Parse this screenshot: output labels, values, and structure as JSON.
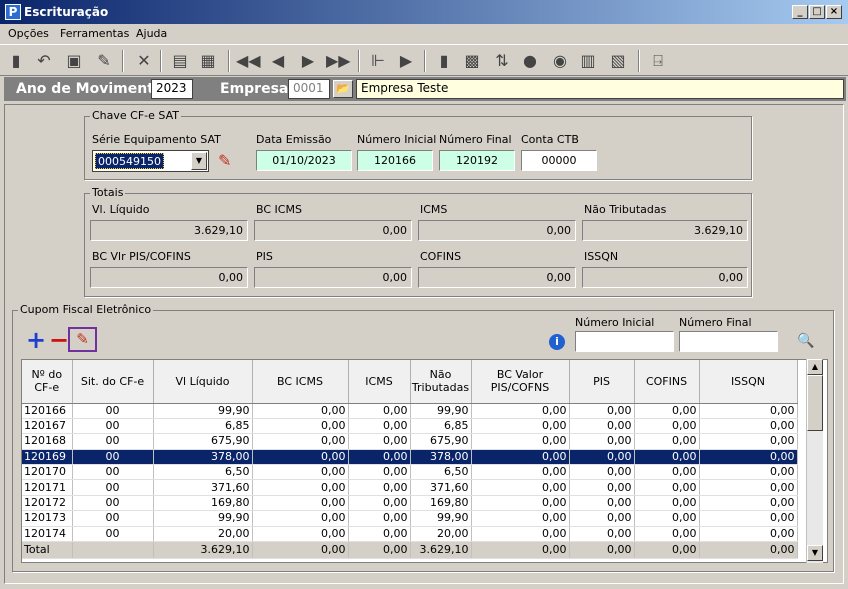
{
  "window": {
    "title": "Escrituração"
  },
  "menu": [
    "Opções",
    "Ferramentas",
    "Ajuda"
  ],
  "header": {
    "year_label": "Ano de Movimento",
    "year_value": "2023",
    "company_label": "Empresa",
    "company_code": "0001",
    "company_name": "Empresa Teste"
  },
  "chave": {
    "group_label": "Chave CF-e SAT",
    "serie_label": "Série Equipamento SAT",
    "serie_value": "000549150",
    "data_label": "Data Emissão",
    "data_value": "01/10/2023",
    "num_ini_label": "Número Inicial",
    "num_ini_value": "120166",
    "num_fim_label": "Número Final",
    "num_fim_value": "120192",
    "conta_label": "Conta CTB",
    "conta_value": "00000"
  },
  "totais": {
    "group_label": "Totais",
    "vl_liquido_label": "Vl. Líquido",
    "vl_liquido": "3.629,10",
    "bc_icms_label": "BC ICMS",
    "bc_icms": "0,00",
    "icms_label": "ICMS",
    "icms": "0,00",
    "nao_trib_label": "Não Tributadas",
    "nao_trib": "3.629,10",
    "bc_pis_label": "BC Vlr PIS/COFINS",
    "bc_pis": "0,00",
    "pis_label": "PIS",
    "pis": "0,00",
    "cofins_label": "COFINS",
    "cofins": "0,00",
    "issqn_label": "ISSQN",
    "issqn": "0,00"
  },
  "cupom": {
    "group_label": "Cupom Fiscal Eletrônico",
    "filter_ini_label": "Número Inicial",
    "filter_fim_label": "Número Final",
    "columns": [
      "Nº do CF-e",
      "Sit. do CF-e",
      "Vl Líquido",
      "BC ICMS",
      "ICMS",
      "Não Tributadas",
      "BC Valor PIS/COFNS",
      "PIS",
      "COFINS",
      "ISSQN"
    ],
    "rows": [
      [
        "120166",
        "00",
        "99,90",
        "0,00",
        "0,00",
        "99,90",
        "0,00",
        "0,00",
        "0,00",
        "0,00"
      ],
      [
        "120167",
        "00",
        "6,85",
        "0,00",
        "0,00",
        "6,85",
        "0,00",
        "0,00",
        "0,00",
        "0,00"
      ],
      [
        "120168",
        "00",
        "675,90",
        "0,00",
        "0,00",
        "675,90",
        "0,00",
        "0,00",
        "0,00",
        "0,00"
      ],
      [
        "120169",
        "00",
        "378,00",
        "0,00",
        "0,00",
        "378,00",
        "0,00",
        "0,00",
        "0,00",
        "0,00"
      ],
      [
        "120170",
        "00",
        "6,50",
        "0,00",
        "0,00",
        "6,50",
        "0,00",
        "0,00",
        "0,00",
        "0,00"
      ],
      [
        "120171",
        "00",
        "371,60",
        "0,00",
        "0,00",
        "371,60",
        "0,00",
        "0,00",
        "0,00",
        "0,00"
      ],
      [
        "120172",
        "00",
        "169,80",
        "0,00",
        "0,00",
        "169,80",
        "0,00",
        "0,00",
        "0,00",
        "0,00"
      ],
      [
        "120173",
        "00",
        "99,90",
        "0,00",
        "0,00",
        "99,90",
        "0,00",
        "0,00",
        "0,00",
        "0,00"
      ],
      [
        "120174",
        "00",
        "20,00",
        "0,00",
        "0,00",
        "20,00",
        "0,00",
        "0,00",
        "0,00",
        "0,00"
      ]
    ],
    "selected_row": 3,
    "total": [
      "Total",
      "",
      "3.629,10",
      "0,00",
      "0,00",
      "3.629,10",
      "0,00",
      "0,00",
      "0,00",
      "0,00"
    ]
  },
  "colors": {
    "selection": "#0a246a",
    "mint": "#ccffe6",
    "add": "#1f3fcf",
    "remove": "#d01010",
    "edit_frame": "#7030a0"
  }
}
